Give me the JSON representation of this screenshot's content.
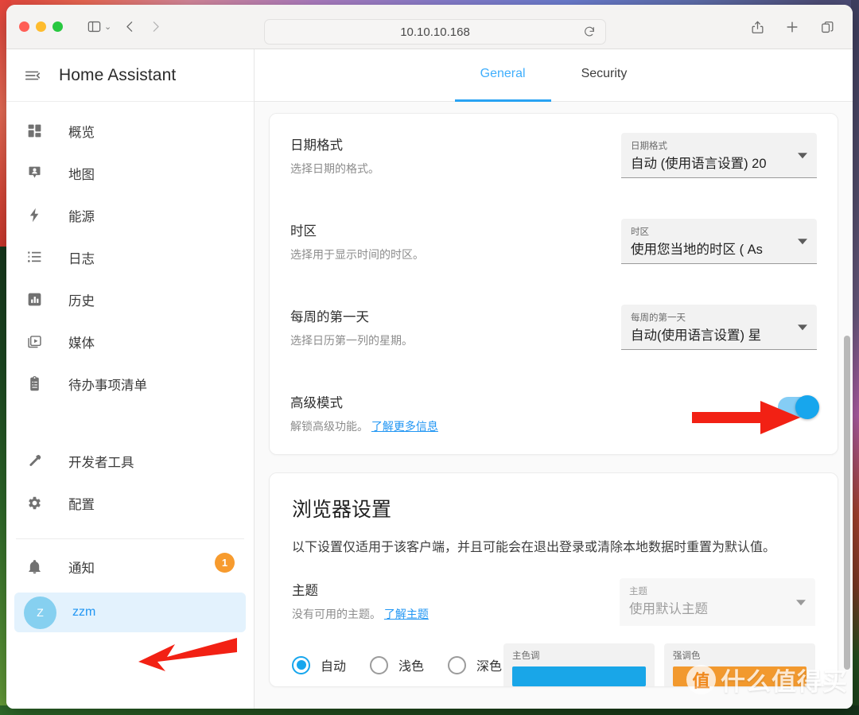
{
  "browser": {
    "url": "10.10.10.168",
    "traffic_lights": [
      "close-red",
      "minimize-yellow",
      "maximize-green"
    ],
    "icons": {
      "sidebar_toggle": "sidebar-toggle-icon",
      "sidebar_chevron": "chevron-down-icon",
      "back": "back-arrow-icon",
      "forward": "forward-arrow-icon",
      "reload": "reload-icon",
      "share": "share-icon",
      "new_tab": "plus-icon",
      "tab_overview": "tab-overview-icon"
    }
  },
  "sidebar": {
    "title": "Home Assistant",
    "items": [
      {
        "label": "概览",
        "icon": "dashboard-icon"
      },
      {
        "label": "地图",
        "icon": "map-marker-account-icon"
      },
      {
        "label": "能源",
        "icon": "lightning-bolt-icon"
      },
      {
        "label": "日志",
        "icon": "format-list-icon"
      },
      {
        "label": "历史",
        "icon": "chart-box-icon"
      },
      {
        "label": "媒体",
        "icon": "play-box-multiple-icon"
      },
      {
        "label": "待办事项清单",
        "icon": "clipboard-list-icon"
      }
    ],
    "tools": [
      {
        "label": "开发者工具",
        "icon": "hammer-icon"
      },
      {
        "label": "配置",
        "icon": "gear-icon"
      }
    ],
    "notifications": {
      "label": "通知",
      "icon": "bell-icon",
      "badge": "1"
    },
    "user": {
      "label": "zzm",
      "initial": "Z"
    }
  },
  "tabs": [
    {
      "label": "General",
      "active": true
    },
    {
      "label": "Security",
      "active": false
    }
  ],
  "general_card": {
    "rows": [
      {
        "title": "日期格式",
        "desc": "选择日期的格式。",
        "control": "select",
        "select_label": "日期格式",
        "select_value": "自动 (使用语言设置) 20"
      },
      {
        "title": "时区",
        "desc": "选择用于显示时间的时区。",
        "control": "select",
        "select_label": "时区",
        "select_value": "使用您当地的时区 ( As"
      },
      {
        "title": "每周的第一天",
        "desc": "选择日历第一列的星期。",
        "control": "select",
        "select_label": "每周的第一天",
        "select_value": "自动(使用语言设置) 星"
      },
      {
        "title": "高级模式",
        "desc": "解锁高级功能。",
        "desc_link": "了解更多信息",
        "control": "toggle",
        "toggle_on": true
      }
    ]
  },
  "browser_settings_card": {
    "title": "浏览器设置",
    "subtitle": "以下设置仅适用于该客户端，并且可能会在退出登录或清除本地数据时重置为默认值。",
    "theme": {
      "title": "主题",
      "desc": "没有可用的主题。",
      "desc_link": "了解主题",
      "select_label": "主题",
      "select_value": "使用默认主题"
    },
    "modes": [
      {
        "label": "自动",
        "checked": true
      },
      {
        "label": "浅色",
        "checked": false
      },
      {
        "label": "深色",
        "checked": false
      }
    ],
    "swatches": [
      {
        "label": "主色调",
        "color": "#19a6e8"
      },
      {
        "label": "强调色",
        "color": "#f2992e"
      }
    ]
  },
  "watermark": {
    "mark": "值",
    "text": "什么值得买"
  },
  "colors": {
    "accent_blue": "#2196f3",
    "tab_underline": "#29a3f3",
    "toggle_on": "#17a6ed",
    "badge_orange": "#f79b2e",
    "arrow_red": "#f22114",
    "user_row_bg": "#e3f2fd",
    "avatar_bg": "#86d0f0"
  }
}
